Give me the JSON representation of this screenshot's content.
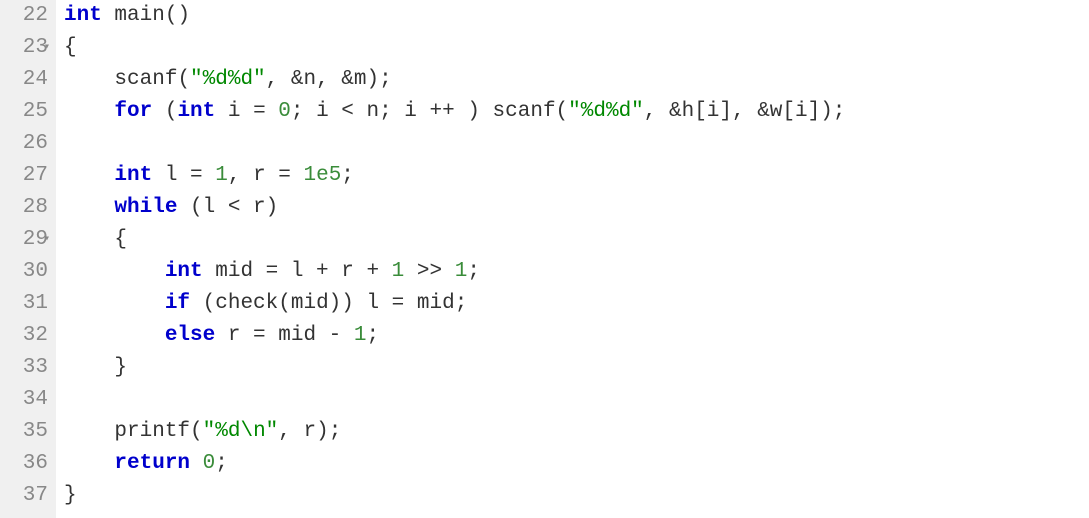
{
  "gutter": {
    "start": 22,
    "end": 37,
    "fold_lines": [
      23,
      29
    ]
  },
  "code": {
    "l22": {
      "kw1": "int",
      "fn": "main",
      "rest": "()"
    },
    "l23": {
      "text": "{"
    },
    "l24": {
      "fn": "scanf",
      "str": "\"%d%d\"",
      "rest1": "(",
      "rest2": ", &n, &m);"
    },
    "l25": {
      "kw1": "for",
      "p1": " (",
      "kw2": "int",
      "mid": " i = ",
      "n0": "0",
      "mid2": "; i < n; i ++ ) ",
      "fn": "scanf",
      "p2": "(",
      "str": "\"%d%d\"",
      "rest": ", &h[i], &w[i]);"
    },
    "l26": {
      "text": ""
    },
    "l27": {
      "kw1": "int",
      "mid1": " l = ",
      "n1": "1",
      "mid2": ", r = ",
      "n2": "1e5",
      "rest": ";"
    },
    "l28": {
      "kw1": "while",
      "rest": " (l < r)"
    },
    "l29": {
      "text": "{"
    },
    "l30": {
      "kw1": "int",
      "mid1": " mid = l + r + ",
      "n1": "1",
      "mid2": " >> ",
      "n2": "1",
      "rest": ";"
    },
    "l31": {
      "kw1": "if",
      "rest": " (check(mid)) l = mid;"
    },
    "l32": {
      "kw1": "else",
      "mid1": " r = mid - ",
      "n1": "1",
      "rest": ";"
    },
    "l33": {
      "text": "}"
    },
    "l34": {
      "text": ""
    },
    "l35": {
      "fn": "printf",
      "p1": "(",
      "str": "\"%d\\n\"",
      "rest": ", r);"
    },
    "l36": {
      "kw1": "return",
      "sp": " ",
      "n1": "0",
      "rest": ";"
    },
    "l37": {
      "text": "}"
    }
  }
}
